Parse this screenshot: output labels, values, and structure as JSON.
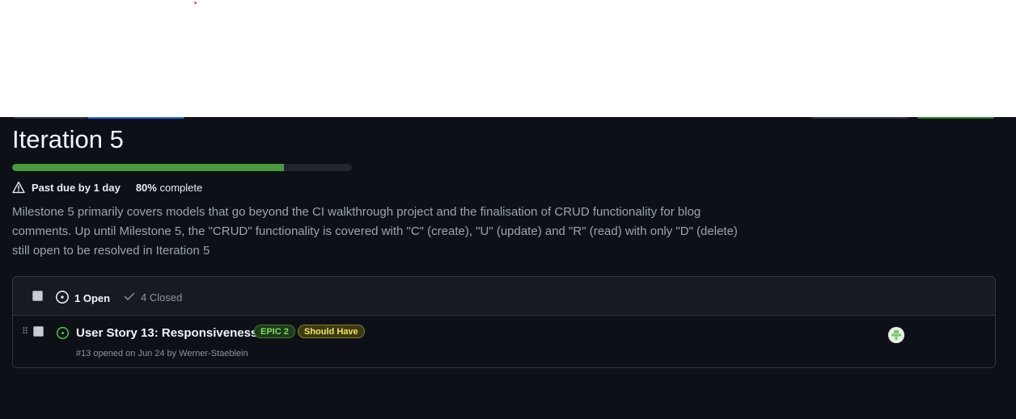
{
  "milestone": {
    "title": "Iteration 5",
    "progress_fraction": 0.8,
    "past_due": "Past due by 1 day",
    "percent_value": "80%",
    "percent_suffix": "complete",
    "description": "Milestone 5 primarily covers models that go beyond the CI walkthrough project and the finalisation of CRUD functionality for blog comments. Up until Milestone 5, the \"CRUD\" functionality is covered with \"C\" (create), \"U\" (update) and \"R\" (read) with only \"D\" (delete) still open to be resolved in Iteration 5"
  },
  "issues_header": {
    "open_label": "1 Open",
    "closed_label": "4 Closed"
  },
  "issues": [
    {
      "title": "User Story 13: Responsiveness",
      "labels": [
        {
          "name": "EPIC 2",
          "color": "#7ddc5f"
        },
        {
          "name": "Should Have",
          "color": "#f2e35c"
        }
      ],
      "meta": "#13 opened on Jun 24 by Werner-Staeblein",
      "status_icon": "issue-open-icon",
      "avatar_icon": "identicon-avatar"
    }
  ],
  "colors": {
    "progress_fill": "#4c9a3f",
    "open_icon": "#3fb950",
    "background": "#0d1117"
  }
}
